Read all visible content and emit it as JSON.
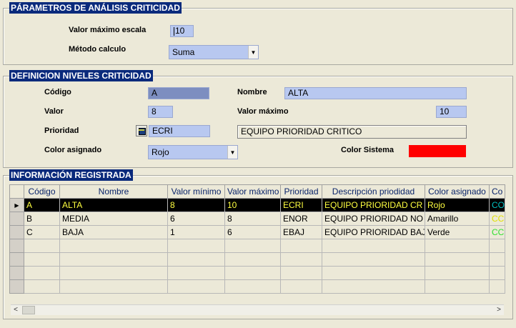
{
  "params": {
    "legend": "PÁRAMETROS DE ANÁLISIS CRITICIDAD",
    "max_scale_label": "Valor máximo escala",
    "max_scale_value": "10",
    "method_label": "Método calculo",
    "method_value": "Suma"
  },
  "levels": {
    "legend": "DEFINICION NIVELES CRITICIDAD",
    "code_label": "Código",
    "code_value": "A",
    "name_label": "Nombre",
    "name_value": "ALTA",
    "value_label": "Valor",
    "value_value": "8",
    "max_label": "Valor máximo",
    "max_value": "10",
    "priority_label": "Prioridad",
    "priority_value": "ECRI",
    "priority_desc": "EQUIPO PRIORIDAD CRITICO",
    "color_label": "Color asignado",
    "color_value": "Rojo",
    "system_color_label": "Color Sistema",
    "system_color_hex": "#ff0000"
  },
  "registry": {
    "legend": "INFORMACIÓN REGISTRADA",
    "columns": [
      "Código",
      "Nombre",
      "Valor mínimo",
      "Valor máximo",
      "Prioridad",
      "Descripción priodidad",
      "Color asignado",
      "Co"
    ],
    "rows": [
      {
        "code": "A",
        "name": "ALTA",
        "min": "8",
        "max": "10",
        "priority": "ECRI",
        "desc": "EQUIPO PRIORIDAD CR",
        "color": "Rojo",
        "co": "CO",
        "co_color": "#00c0c0"
      },
      {
        "code": "B",
        "name": "MEDIA",
        "min": "6",
        "max": "8",
        "priority": "ENOR",
        "desc": "EQUIPO PRIORIDAD NO",
        "color": "Amarillo",
        "co": "CC",
        "co_color": "#e0e000"
      },
      {
        "code": "C",
        "name": "BAJA",
        "min": "1",
        "max": "6",
        "priority": "EBAJ",
        "desc": "EQUIPO PRIORIDAD BAJ",
        "color": "Verde",
        "co": "CC",
        "co_color": "#30e030"
      }
    ],
    "empty_rows": 5
  }
}
